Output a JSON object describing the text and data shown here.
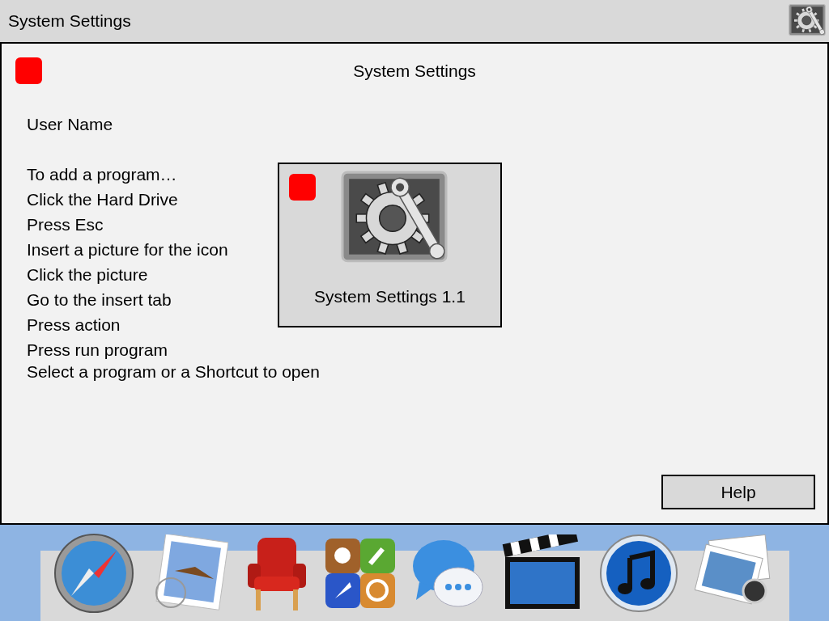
{
  "top_bar": {
    "title": "System Settings"
  },
  "window": {
    "title": "System Settings",
    "user_name": "User Name",
    "instructions": [
      "To add a program…",
      "Click the Hard Drive",
      "Press Esc",
      "Insert a picture for the icon",
      "Click the picture",
      "Go to the insert tab",
      "Press action",
      "Press run program",
      "Select a program or a Shortcut to open"
    ],
    "program_tile": {
      "label": "System Settings 1.1"
    },
    "help_button": "Help"
  }
}
